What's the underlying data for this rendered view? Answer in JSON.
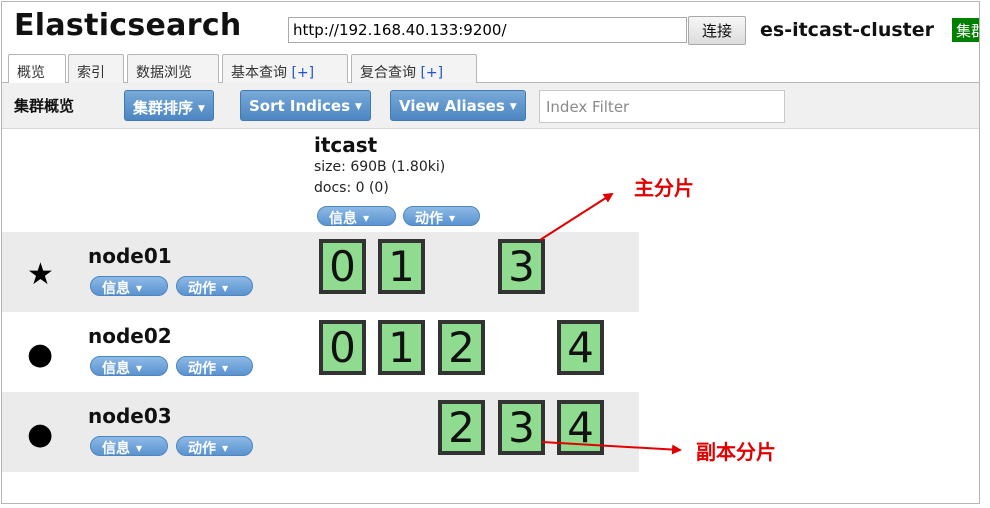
{
  "header": {
    "title": "Elasticsearch",
    "url_value": "http://192.168.40.133:9200/",
    "connect_label": "连接",
    "cluster_name": "es-itcast-cluster",
    "health_label": "集群健康值",
    "health_color": "#008000"
  },
  "tabs": [
    {
      "label": "概览",
      "plus": ""
    },
    {
      "label": "索引",
      "plus": ""
    },
    {
      "label": "数据浏览",
      "plus": ""
    },
    {
      "label": "基本查询 ",
      "plus": "[+]"
    },
    {
      "label": "复合查询 ",
      "plus": "[+]"
    }
  ],
  "toolbar": {
    "title": "集群概览",
    "buttons": [
      "集群排序",
      "Sort Indices",
      "View Aliases"
    ],
    "filter_placeholder": "Index Filter"
  },
  "index": {
    "name": "itcast",
    "size": "size: 690B (1.80ki)",
    "docs": "docs: 0 (0)",
    "info_label": "信息",
    "action_label": "动作"
  },
  "nodes": [
    {
      "name": "node01",
      "icon": "star-icon",
      "glyph": "★",
      "info_label": "信息",
      "action_label": "动作",
      "shards": [
        "0",
        "1",
        "3"
      ]
    },
    {
      "name": "node02",
      "icon": "circle-icon",
      "glyph": "●",
      "info_label": "信息",
      "action_label": "动作",
      "shards": [
        "0",
        "1",
        "2",
        "4"
      ]
    },
    {
      "name": "node03",
      "icon": "circle-icon",
      "glyph": "●",
      "info_label": "信息",
      "action_label": "动作",
      "shards": [
        "2",
        "3",
        "4"
      ]
    }
  ],
  "annotations": {
    "primary": "主分片",
    "replica": "副本分片",
    "color": "#e00000"
  },
  "colors": {
    "button_blue": "#4c86c2",
    "shard_green": "#8fdb8f"
  }
}
